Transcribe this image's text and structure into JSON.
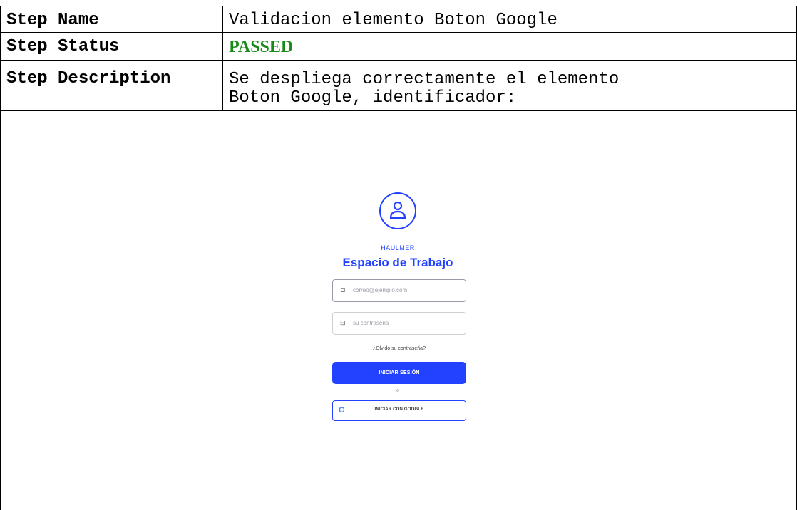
{
  "report": {
    "step_name_label": "Step Name",
    "step_name_value": "Validacion elemento Boton Google",
    "step_status_label": "Step Status",
    "step_status_value": "PASSED",
    "step_description_label": "Step Description",
    "step_description_line1": "Se despliega correctamente el elemento",
    "step_description_line2": "Boton Google, identificador:"
  },
  "screenshot": {
    "brand": "HAULMER",
    "title": "Espacio de Trabajo",
    "email_placeholder": "correo@ejemplo.com",
    "password_placeholder": "su contraseña",
    "forgot_link": "¿Olvidó su contraseña?",
    "login_button": "INICIAR SESIÓN",
    "divider_text": "o",
    "google_button": "INICIAR CON GOOGLE",
    "google_letter": "G",
    "colors": {
      "primary": "#2242ff",
      "passed": "#178a17"
    }
  }
}
